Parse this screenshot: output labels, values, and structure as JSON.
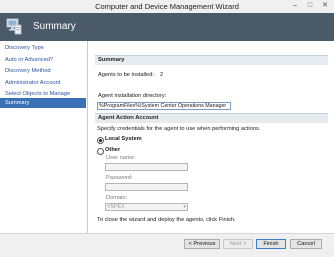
{
  "window": {
    "title": "Computer and Device Management Wizard",
    "minimize": "–",
    "maximize": "□",
    "close": "✕"
  },
  "header": {
    "title": "Summary",
    "icon": "wizard-computer-icon"
  },
  "nav": {
    "items": [
      {
        "label": "Discovery Type",
        "active": false
      },
      {
        "label": "Auto or Advanced?",
        "active": false
      },
      {
        "label": "Discovery Method",
        "active": false
      },
      {
        "label": "Administrator Account",
        "active": false
      },
      {
        "label": "Select Objects to Manage",
        "active": false
      },
      {
        "label": "Summary",
        "active": true
      }
    ]
  },
  "summary": {
    "section_title": "Summary",
    "agents_label": "Agents to be installed:",
    "agents_value": "2",
    "dir_label": "Agent installation directory:",
    "dir_value": "%ProgramFiles%\\System Center Operations Manager"
  },
  "account": {
    "section_title": "Agent Action Account",
    "description": "Specify credentials for the agent to use when performing actions.",
    "local_system_label": "Local System",
    "local_system_selected": true,
    "other_label": "Other",
    "other_selected": false,
    "username_label": "User name:",
    "username_value": "",
    "password_label": "Password:",
    "password_value": "",
    "domain_label": "Domain:",
    "domain_value": "VSPEX"
  },
  "finish_text": "To close the wizard and deploy the agents, click Finish.",
  "buttons": {
    "previous": "< Previous",
    "next": "Next >",
    "finish": "Finish",
    "cancel": "Cancel"
  },
  "colors": {
    "header_bg": "#4a5a68",
    "nav_active": "#3b6fb6",
    "nav_link": "#2a55a5"
  }
}
